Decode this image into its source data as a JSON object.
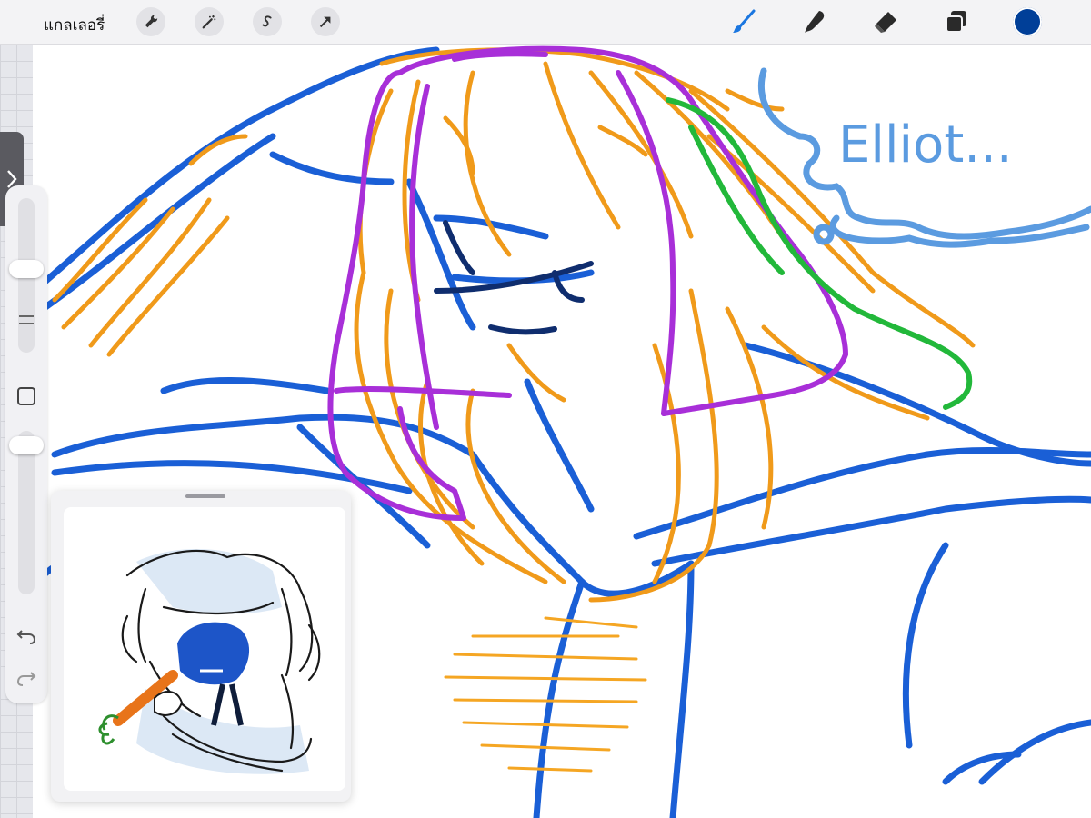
{
  "topbar": {
    "gallery_label": "แกลเลอรี่",
    "left_tools": [
      "wrench-icon",
      "magic-wand-icon",
      "selection-icon",
      "transform-arrow-icon"
    ],
    "right_tools": [
      "brush-icon",
      "smudge-icon",
      "eraser-icon",
      "layers-icon"
    ],
    "active_color": "#003f98"
  },
  "canvas": {
    "speech_text": "Elliot..."
  },
  "colors": {
    "stroke_blue": "#1a5fd6",
    "stroke_orange": "#f09a1a",
    "stroke_purple": "#a82fd8",
    "stroke_green": "#22b83a",
    "light_blue": "#5b9be0"
  }
}
